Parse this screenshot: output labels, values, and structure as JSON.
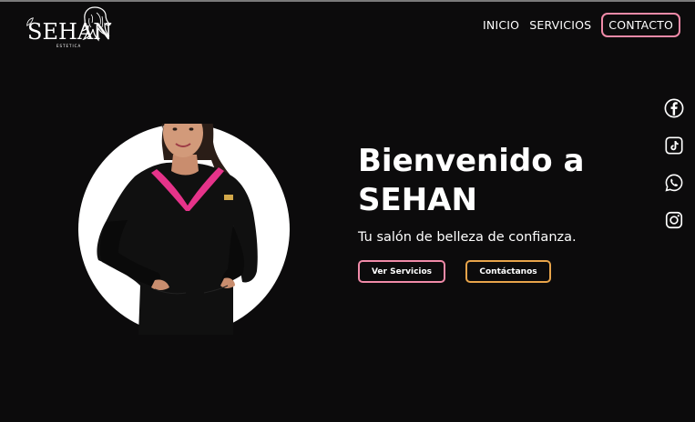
{
  "brand": {
    "name": "SEHAN",
    "tagline": "ESTETICA"
  },
  "nav": {
    "items": [
      {
        "label": "INICIO"
      },
      {
        "label": "SERVICIOS"
      },
      {
        "label": "CONTACTO",
        "active": true
      }
    ]
  },
  "hero": {
    "title_line1": "Bienvenido a",
    "title_line2": "SEHAN",
    "subtitle": "Tu salón de belleza de confianza.",
    "primary_button": "Ver Servicios",
    "secondary_button": "Contáctanos"
  },
  "social": {
    "icons": [
      "facebook-icon",
      "tiktok-icon",
      "whatsapp-icon",
      "instagram-icon"
    ]
  },
  "colors": {
    "background": "#0c0b0c",
    "accent_pink": "#f08aa8",
    "accent_gold": "#e8a44a",
    "uniform_pink": "#e6338a",
    "text": "#ffffff"
  }
}
